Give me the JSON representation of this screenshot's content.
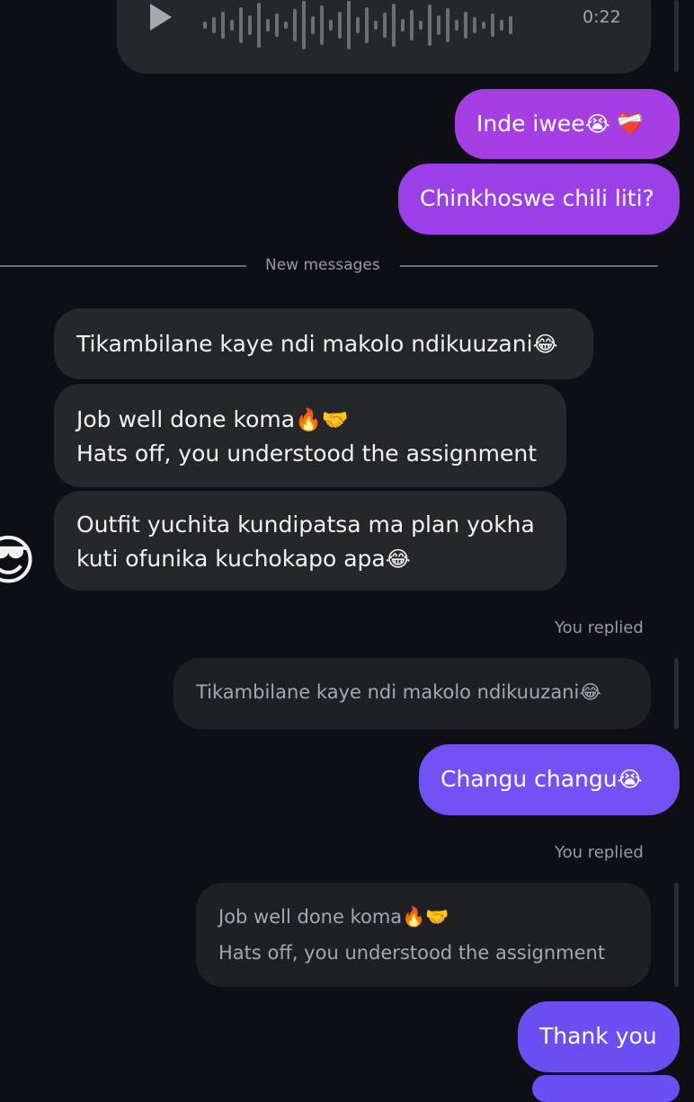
{
  "voice_message": {
    "duration": "0:22",
    "play_icon": "play-icon"
  },
  "messages_top": [
    {
      "text": "Inde iwee",
      "emoji": "😭 ❤️‍🩹"
    },
    {
      "text": "Chinkhoswe chili liti?"
    }
  ],
  "divider": {
    "label": "New messages"
  },
  "received": [
    {
      "text": "Tikambilane kaye ndi makolo ndikuuzani",
      "emoji": "😂"
    },
    {
      "line1": "Job well done koma",
      "emoji": "🔥🤝",
      "line2": "Hats off, you understood the assignment"
    },
    {
      "line1": "Outfit yuchita kundipatsa ma plan yokha",
      "line2": "kuti ofunika kuchokapo apa",
      "emoji": "😂"
    }
  ],
  "avatar": {
    "emoji": "😎"
  },
  "replies": [
    {
      "label": "You replied",
      "quoted": "Tikambilane kaye ndi makolo ndikuuzani",
      "quoted_emoji": "😂",
      "message": "Changu changu",
      "message_emoji": "😭"
    },
    {
      "label": "You replied",
      "quoted_line1": "Job well done koma",
      "quoted_emoji": "🔥🤝",
      "quoted_line2": "Hats off, you understood the assignment",
      "message": "Thank you"
    }
  ],
  "colors": {
    "background": "#0d0f14",
    "received_bubble": "#26272b",
    "sent_purple": "#9d3fe6",
    "sent_violet": "#6b4ff2"
  }
}
